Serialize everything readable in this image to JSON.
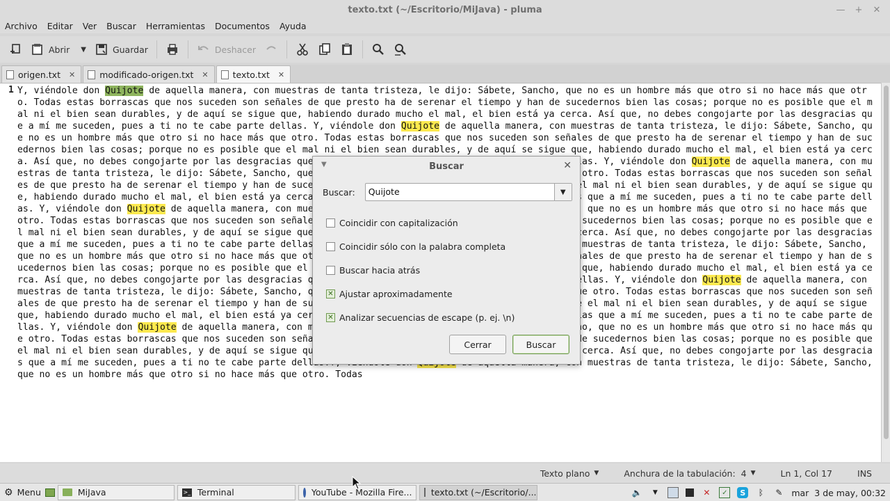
{
  "window": {
    "title": "texto.txt (~/Escritorio/MiJava) - pluma"
  },
  "menu": [
    "Archivo",
    "Editar",
    "Ver",
    "Buscar",
    "Herramientas",
    "Documentos",
    "Ayuda"
  ],
  "toolbar": {
    "open": "Abrir",
    "save": "Guardar",
    "undo": "Deshacer"
  },
  "tabs": [
    {
      "label": "origen.txt"
    },
    {
      "label": "modificado-origen.txt"
    },
    {
      "label": "texto.txt"
    }
  ],
  "editor": {
    "line_number": "1",
    "search_term": "Quijote",
    "text": "Y, viéndole don Quijote de aquella manera, con muestras de tanta tristeza, le dijo: Sábete, Sancho, que no es un hombre más que otro si no hace más que otro. Todas estas borrascas que nos suceden son señales de que presto ha de serenar el tiempo y han de sucedernos bien las cosas; porque no es posible que el mal ni el bien sean durables, y de aquí se sigue que, habiendo durado mucho el mal, el bien está ya cerca. Así que, no debes congojarte por las desgracias que a mí me suceden, pues a ti no te cabe parte dellas. Y, viéndole don Quijote de aquella manera, con muestras de tanta tristeza, le dijo: Sábete, Sancho, que no es un hombre más que otro si no hace más que otro. Todas estas borrascas que nos suceden son señales de que presto ha de serenar el tiempo y han de sucedernos bien las cosas; porque no es posible que el mal ni el bien sean durables, y de aquí se sigue que, habiendo durado mucho el mal, el bien está ya cerca. Así que, no debes congojarte por las desgracias que a mí me suceden, pues a ti no te cabe parte dellas. Y, viéndole don Quijote de aquella manera, con muestras de tanta tristeza, le dijo: Sábete, Sancho, que no es un hombre más que otro si no hace más que otro. Todas estas borrascas que nos suceden son señales de que presto ha de serenar el tiempo y han de sucedernos bien las cosas; porque no es posible que el mal ni el bien sean durables, y de aquí se sigue que, habiendo durado mucho el mal, el bien está ya cerca. Así que, no debes congojarte por las desgracias que a mí me suceden, pues a ti no te cabe parte dellas. Y, viéndole don Quijote de aquella manera, con muestras de tanta tristeza, le dijo: Sábete, Sancho, que no es un hombre más que otro si no hace más que otro. Todas estas borrascas que nos suceden son señales de que presto ha de serenar el tiempo y han de sucedernos bien las cosas; porque no es posible que el mal ni el bien sean durables, y de aquí se sigue que, habiendo durado mucho el mal, el bien está ya cerca. Así que, no debes congojarte por las desgracias que a mí me suceden, pues a ti no te cabe parte dellas. Y, viéndole don Quijote de aquella manera, con muestras de tanta tristeza, le dijo: Sábete, Sancho, que no es un hombre más que otro si no hace más que otro. Todas estas borrascas que nos suceden son señales de que presto ha de serenar el tiempo y han de sucedernos bien las cosas; porque no es posible que el mal ni el bien sean durables, y de aquí se sigue que, habiendo durado mucho el mal, el bien está ya cerca. Así que, no debes congojarte por las desgracias que a mí me suceden, pues a ti no te cabe parte dellas. Y, viéndole don Quijote de aquella manera, con muestras de tanta tristeza, le dijo: Sábete, Sancho, que no es un hombre más que otro si no hace más que otro. Todas estas borrascas que nos suceden son señales de que presto ha de serenar el tiempo y han de sucedernos bien las cosas; porque no es posible que el mal ni el bien sean durables, y de aquí se sigue que, habiendo durado mucho el mal, el bien está ya cerca. Así que, no debes congojarte por las desgracias que a mí me suceden, pues a ti no te cabe parte dellas. Y, viéndole don Quijote de aquella manera, con muestras de tanta tristeza, le dijo: Sábete, Sancho, que no es un hombre más que otro si no hace más que otro. Todas estas borrascas que nos suceden son señales de que presto ha de serenar el tiempo y han de sucedernos bien las cosas; porque no es posible que el mal ni el bien sean durables, y de aquí se sigue que, habiendo durado mucho el mal, el bien está ya cerca. Así que, no debes congojarte por las desgracias que a mí me suceden, pues a ti no te cabe parte dellas.Y, viéndole don Quijote de aquella manera, con muestras de tanta tristeza, le dijo: Sábete, Sancho, que no es un hombre más que otro si no hace más que otro. Todas"
  },
  "dialog": {
    "title": "Buscar",
    "search_label": "Buscar:",
    "search_value": "Quijote",
    "options": [
      {
        "label": "Coincidir con capitalización",
        "checked": false
      },
      {
        "label": "Coincidir sólo con la palabra completa",
        "checked": false
      },
      {
        "label": "Buscar hacia atrás",
        "checked": false
      },
      {
        "label": "Ajustar aproximadamente",
        "checked": true
      },
      {
        "label": "Analizar secuencias de escape (p. ej. \\n)",
        "checked": true
      }
    ],
    "close_label": "Cerrar",
    "find_label": "Buscar"
  },
  "status": {
    "language": "Texto plano",
    "tab_width": "Anchura de la tabulación:  4",
    "position": "Ln 1, Col 17",
    "mode": "INS"
  },
  "panel": {
    "menu_label": "Menu",
    "tasks": [
      {
        "label": "MiJava",
        "icon": "folder-icon"
      },
      {
        "label": "Terminal",
        "icon": "terminal-icon"
      },
      {
        "label": "YouTube - Mozilla Fire...",
        "icon": "firefox-icon"
      },
      {
        "label": "texto.txt (~/Escritorio/...",
        "icon": "text-editor-icon"
      }
    ],
    "clock": "mar  3 de may, 00:32"
  },
  "colors": {
    "highlight": "#fce94f",
    "selection": "#8fb55e",
    "chrome": "#dcdcdc"
  }
}
